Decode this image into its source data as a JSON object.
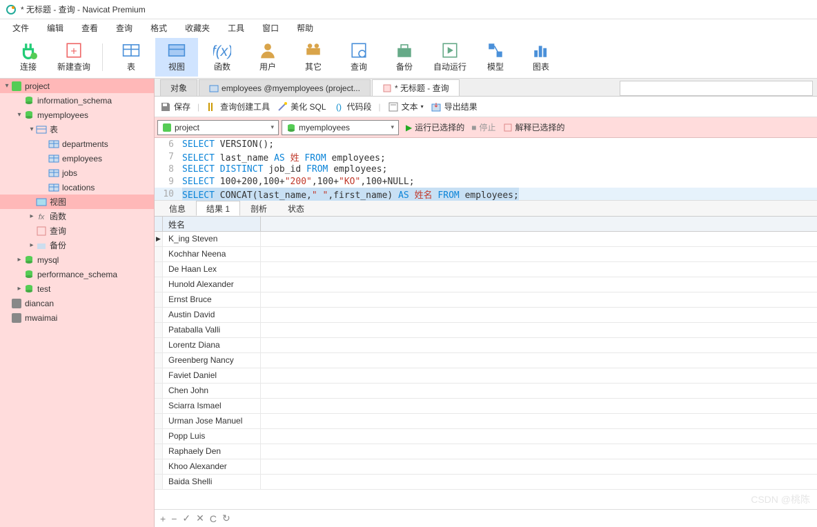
{
  "title": "* 无标题 - 查询 - Navicat Premium",
  "menu": [
    "文件",
    "编辑",
    "查看",
    "查询",
    "格式",
    "收藏夹",
    "工具",
    "窗口",
    "帮助"
  ],
  "toolbar": [
    {
      "label": "连接",
      "icon": "plug",
      "color": "#2c7"
    },
    {
      "label": "新建查询",
      "icon": "newq",
      "color": "#e66"
    },
    {
      "label": "表",
      "icon": "table",
      "color": "#4a90d9",
      "sep_before": true
    },
    {
      "label": "视图",
      "icon": "view",
      "color": "#4a90d9",
      "active": true
    },
    {
      "label": "函数",
      "icon": "fx",
      "color": "#4a90d9"
    },
    {
      "label": "用户",
      "icon": "user",
      "color": "#d9a44a"
    },
    {
      "label": "其它",
      "icon": "other",
      "color": "#d9a44a"
    },
    {
      "label": "查询",
      "icon": "query",
      "color": "#4a90d9"
    },
    {
      "label": "备份",
      "icon": "backup",
      "color": "#6a8"
    },
    {
      "label": "自动运行",
      "icon": "auto",
      "color": "#6a8"
    },
    {
      "label": "模型",
      "icon": "model",
      "color": "#4a90d9"
    },
    {
      "label": "图表",
      "icon": "chart",
      "color": "#4a90d9"
    }
  ],
  "tree": [
    {
      "depth": 0,
      "label": "project",
      "icon": "conn",
      "arrow": "▾",
      "selected": true
    },
    {
      "depth": 1,
      "label": "information_schema",
      "icon": "db"
    },
    {
      "depth": 1,
      "label": "myemployees",
      "icon": "db",
      "arrow": "▾"
    },
    {
      "depth": 2,
      "label": "表",
      "icon": "tbls",
      "arrow": "▾"
    },
    {
      "depth": 3,
      "label": "departments",
      "icon": "tbl"
    },
    {
      "depth": 3,
      "label": "employees",
      "icon": "tbl"
    },
    {
      "depth": 3,
      "label": "jobs",
      "icon": "tbl"
    },
    {
      "depth": 3,
      "label": "locations",
      "icon": "tbl"
    },
    {
      "depth": 2,
      "label": "视图",
      "icon": "view",
      "selected2": true
    },
    {
      "depth": 2,
      "label": "函数",
      "icon": "fx",
      "arrow": "▸"
    },
    {
      "depth": 2,
      "label": "查询",
      "icon": "qry"
    },
    {
      "depth": 2,
      "label": "备份",
      "icon": "bak",
      "arrow": "▸"
    },
    {
      "depth": 1,
      "label": "mysql",
      "icon": "db",
      "arrow": "▸"
    },
    {
      "depth": 1,
      "label": "performance_schema",
      "icon": "db"
    },
    {
      "depth": 1,
      "label": "test",
      "icon": "db",
      "arrow": "▸"
    },
    {
      "depth": 0,
      "label": "diancan",
      "icon": "conn-off"
    },
    {
      "depth": 0,
      "label": "mwaimai",
      "icon": "conn-off"
    }
  ],
  "tabs1": [
    {
      "label": "对象",
      "active": false
    },
    {
      "label": "employees @myemployees (project...",
      "icon": "tbl",
      "active": false
    },
    {
      "label": "* 无标题 - 查询",
      "icon": "qry",
      "active": true
    }
  ],
  "toolbar2": [
    {
      "label": "保存",
      "icon": "save"
    },
    {
      "label": "查询创建工具",
      "icon": "tool"
    },
    {
      "label": "美化 SQL",
      "icon": "wand"
    },
    {
      "label": "代码段",
      "icon": "snip"
    },
    {
      "label": "文本",
      "icon": "text",
      "drop": true
    },
    {
      "label": "导出结果",
      "icon": "export"
    }
  ],
  "selectors": {
    "conn": "project",
    "db": "myemployees"
  },
  "runbar": {
    "run": "运行已选择的",
    "stop": "停止",
    "explain": "解释已选择的"
  },
  "editor": [
    {
      "n": 6,
      "tokens": [
        [
          "kw",
          "SELECT"
        ],
        [
          "sp",
          " "
        ],
        [
          "fn",
          "VERSION"
        ],
        [
          "pl",
          "();"
        ]
      ]
    },
    {
      "n": 7,
      "tokens": [
        [
          "kw",
          "SELECT"
        ],
        [
          "sp",
          " "
        ],
        [
          "pl",
          "last_name "
        ],
        [
          "kw",
          "AS"
        ],
        [
          "sp",
          " "
        ],
        [
          "al",
          "姓"
        ],
        [
          "sp",
          " "
        ],
        [
          "kw",
          "FROM"
        ],
        [
          "sp",
          " "
        ],
        [
          "pl",
          "employees;"
        ]
      ]
    },
    {
      "n": 8,
      "tokens": [
        [
          "kw",
          "SELECT"
        ],
        [
          "sp",
          " "
        ],
        [
          "kw",
          "DISTINCT"
        ],
        [
          "sp",
          " "
        ],
        [
          "pl",
          "job_id "
        ],
        [
          "kw",
          "FROM"
        ],
        [
          "sp",
          " "
        ],
        [
          "pl",
          "employees;"
        ]
      ]
    },
    {
      "n": 9,
      "tokens": [
        [
          "kw",
          "SELECT"
        ],
        [
          "sp",
          " "
        ],
        [
          "pl",
          "100+200,100+"
        ],
        [
          "str",
          "\"200\""
        ],
        [
          "pl",
          ",100+"
        ],
        [
          "str",
          "\"KO\""
        ],
        [
          "pl",
          ",100+NULL;"
        ]
      ]
    },
    {
      "n": 10,
      "sel": true,
      "tokens": [
        [
          "kw",
          "SELECT"
        ],
        [
          "sp",
          " "
        ],
        [
          "fn",
          "CONCAT"
        ],
        [
          "pl",
          "(last_name,"
        ],
        [
          "str",
          "\" \""
        ],
        [
          "pl",
          ",first_name) "
        ],
        [
          "kw",
          "AS"
        ],
        [
          "sp",
          " "
        ],
        [
          "al",
          "姓名"
        ],
        [
          "sp",
          " "
        ],
        [
          "kw",
          "FROM"
        ],
        [
          "sp",
          " "
        ],
        [
          "pl",
          "employees;"
        ]
      ]
    }
  ],
  "tabs2": [
    "信息",
    "结果 1",
    "剖析",
    "状态"
  ],
  "tabs2_active": 1,
  "grid": {
    "header": "姓名",
    "rows": [
      "K_ing Steven",
      "Kochhar Neena",
      "De Haan Lex",
      "Hunold Alexander",
      "Ernst Bruce",
      "Austin David",
      "Pataballa Valli",
      "Lorentz Diana",
      "Greenberg Nancy",
      "Faviet Daniel",
      "Chen John",
      "Sciarra Ismael",
      "Urman Jose Manuel",
      "Popp Luis",
      "Raphaely Den",
      "Khoo Alexander",
      "Baida Shelli"
    ]
  },
  "statusbar": {
    "icons": [
      "+",
      "−",
      "✓",
      "✕",
      "C",
      "↻"
    ]
  },
  "watermark": "CSDN @桃陈"
}
